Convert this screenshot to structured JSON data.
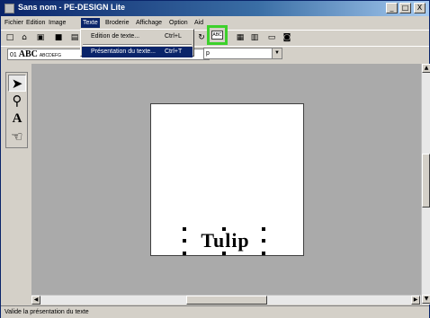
{
  "window": {
    "title": "Sans nom - PE-DESIGN Lite"
  },
  "window_controls": {
    "minimize": "_",
    "maximize": "□",
    "close": "X"
  },
  "menubar": {
    "items": [
      {
        "label": "Fichier"
      },
      {
        "label": "Edition"
      },
      {
        "label": "Image"
      },
      {
        "label": "Texte"
      },
      {
        "label": "Broderie"
      },
      {
        "label": "Affichage"
      },
      {
        "label": "Option"
      },
      {
        "label": "Aid"
      }
    ]
  },
  "text_menu": {
    "items": [
      {
        "label": "Edition de texte...",
        "shortcut": "Ctrl+L"
      },
      {
        "label": "Présentation du texte...",
        "shortcut": "Ctrl+T"
      }
    ]
  },
  "toolbar2": {
    "font_number": "01",
    "font_sample": "ABC",
    "font_sample_small": "ABCDEFG",
    "size_value": "p"
  },
  "highlight_button": {
    "label": "ABC"
  },
  "canvas": {
    "text": "Tulip"
  },
  "statusbar": {
    "text": "Valide la présentation du texte"
  },
  "colors": {
    "highlight": "#3dd12c",
    "menu_highlight": "#0a246a",
    "workspace": "#aaaaaa"
  },
  "icons": [
    "new-icon",
    "open-icon",
    "save-icon",
    "select-arrow-icon",
    "zoom-icon",
    "text-tool-icon",
    "embroidery-hand-icon"
  ]
}
